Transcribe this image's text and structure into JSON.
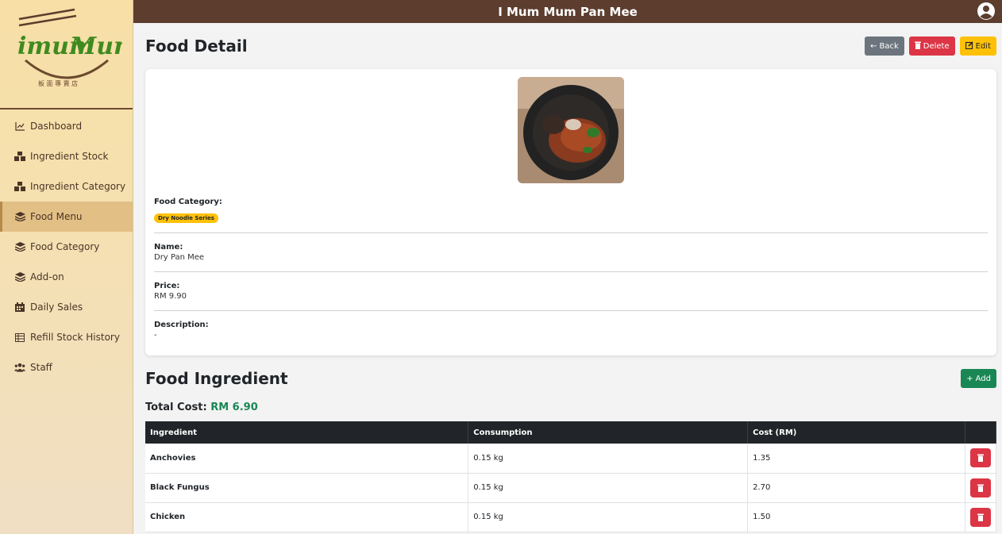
{
  "app": {
    "title": "I Mum Mum Pan Mee",
    "logo_text": "imumMum",
    "logo_subtext": "板面專賣店"
  },
  "sidebar": {
    "items": [
      {
        "label": "Dashboard",
        "icon": "chart-line-icon"
      },
      {
        "label": "Ingredient Stock",
        "icon": "boxes-icon"
      },
      {
        "label": "Ingredient Category",
        "icon": "boxes-icon"
      },
      {
        "label": "Food Menu",
        "icon": "layers-icon",
        "active": true
      },
      {
        "label": "Food Category",
        "icon": "layers-icon"
      },
      {
        "label": "Add-on",
        "icon": "layers-icon"
      },
      {
        "label": "Daily Sales",
        "icon": "calendar-icon"
      },
      {
        "label": "Refill Stock History",
        "icon": "table-icon"
      },
      {
        "label": "Staff",
        "icon": "users-icon"
      }
    ]
  },
  "detail": {
    "title": "Food Detail",
    "back_label": "Back",
    "delete_label": "Delete",
    "edit_label": "Edit",
    "category_label": "Food Category:",
    "category_value": "Dry Noodle Series",
    "name_label": "Name:",
    "name_value": "Dry Pan Mee",
    "price_label": "Price:",
    "price_value": "RM 9.90",
    "description_label": "Description:",
    "description_value": "-"
  },
  "ingredients": {
    "title": "Food Ingredient",
    "add_label": "Add",
    "total_label": "Total Cost:",
    "total_value": "RM 6.90",
    "columns": [
      "Ingredient",
      "Consumption",
      "Cost (RM)"
    ],
    "rows": [
      {
        "name": "Anchovies",
        "consumption": "0.15 kg",
        "cost": "1.35"
      },
      {
        "name": "Black Fungus",
        "consumption": "0.15 kg",
        "cost": "2.70"
      },
      {
        "name": "Chicken",
        "consumption": "0.15 kg",
        "cost": "1.50"
      }
    ]
  },
  "colors": {
    "header_bg": "#5c3d2e",
    "accent_green": "#198754",
    "danger": "#dc3545",
    "warning": "#ffc107"
  }
}
